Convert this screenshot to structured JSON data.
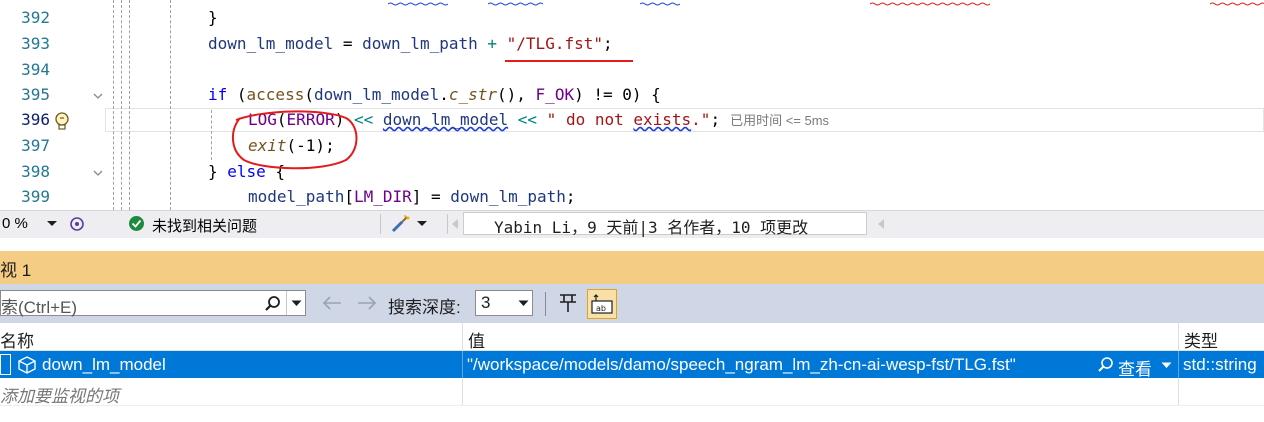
{
  "editor": {
    "line_numbers": [
      "392",
      "393",
      "394",
      "395",
      "396",
      "397",
      "398",
      "399"
    ],
    "hint_text": "已用时间 <= 5ms"
  },
  "status_bar": {
    "zoom": "0 %",
    "issues_text": "未找到相关问题",
    "git_blame": "Yabin Li，9 天前|3 名作者，10 项更改"
  },
  "watch_panel": {
    "title": "视 1",
    "search_placeholder": "索(Ctrl+E)",
    "search_depth_label": "搜索深度:",
    "search_depth_value": "3",
    "columns": {
      "name": "名称",
      "value": "值",
      "type": "类型"
    },
    "rows": [
      {
        "name": "down_lm_model",
        "value": "\"/workspace/models/damo/speech_ngram_lm_zh-cn-ai-wesp-fst/TLG.fst\"",
        "view_label": "查看",
        "type": "std::string"
      }
    ],
    "add_item_placeholder": "添加要监视的项"
  },
  "colors": {
    "selection": "#0078d7",
    "panel_tab": "#f5cc84",
    "toolbar": "#cfd6e5",
    "annotation": "#e31b1b"
  }
}
